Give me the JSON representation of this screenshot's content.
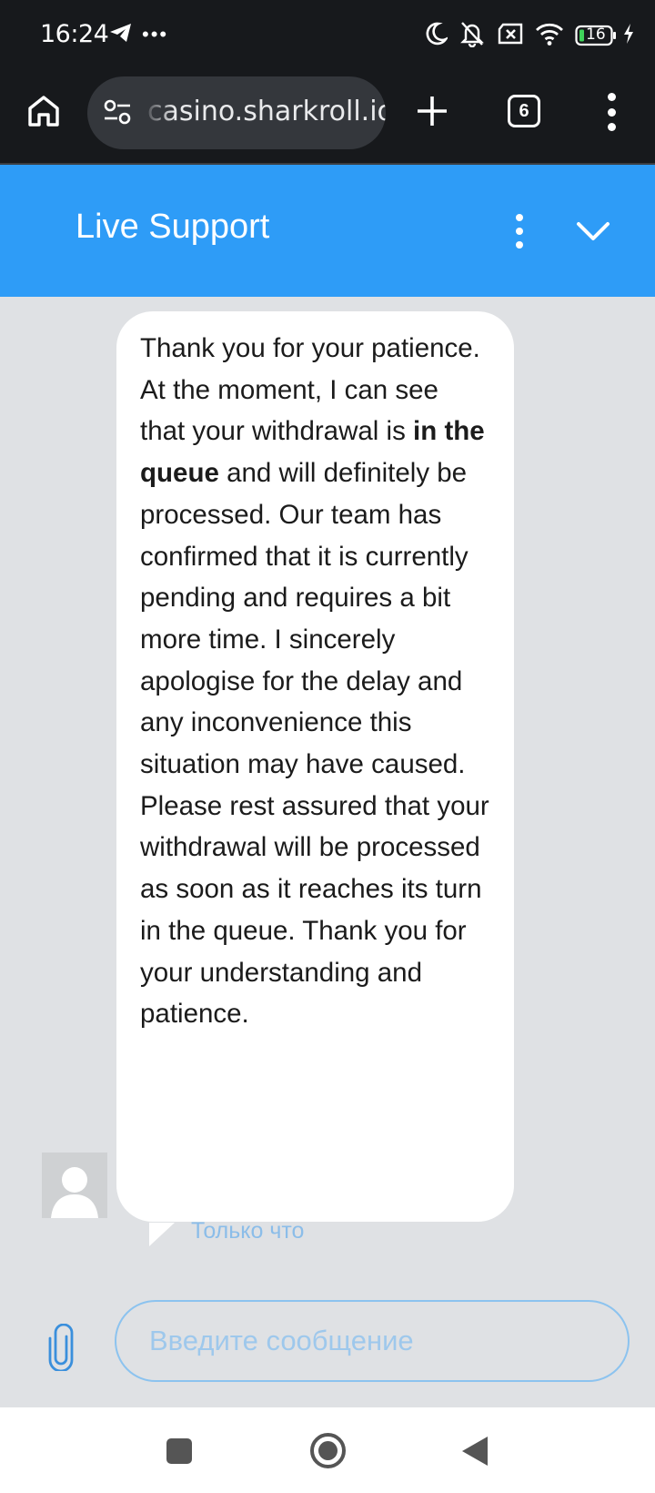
{
  "status_bar": {
    "time": "16:24",
    "battery": "16",
    "icons": [
      "telegram-icon",
      "more-dots-icon",
      "moon-icon",
      "bell-muted-icon",
      "no-sim-icon",
      "wifi-icon",
      "battery-icon",
      "charging-icon"
    ]
  },
  "browser": {
    "url": "casino.sharkroll.io",
    "tab_count": "6",
    "icons": [
      "home-icon",
      "site-settings-icon",
      "plus-icon",
      "tabs-icon",
      "more-vert-icon"
    ]
  },
  "chat_header": {
    "title": "Live Support",
    "background": "#2e9cf7"
  },
  "message": {
    "text_before_bold": "Thank you for your patience. At the moment, I can see that your withdrawal is ",
    "bold_text": "in the queue",
    "text_after_bold": " and will definitely be processed. Our team has confirmed that it is currently pending and requires a bit more time. I sincerely apologise for the delay and any inconvenience this situation may have caused. Please rest assured that your withdrawal will be processed as soon as it reaches its turn in the queue. Thank you for your understanding and patience.",
    "time": "Только что"
  },
  "composer": {
    "placeholder": "Введите сообщение",
    "value": ""
  },
  "colors": {
    "accent": "#2e9cf7",
    "chat_background": "#dfe1e4",
    "input_border": "#8cc3ef"
  }
}
